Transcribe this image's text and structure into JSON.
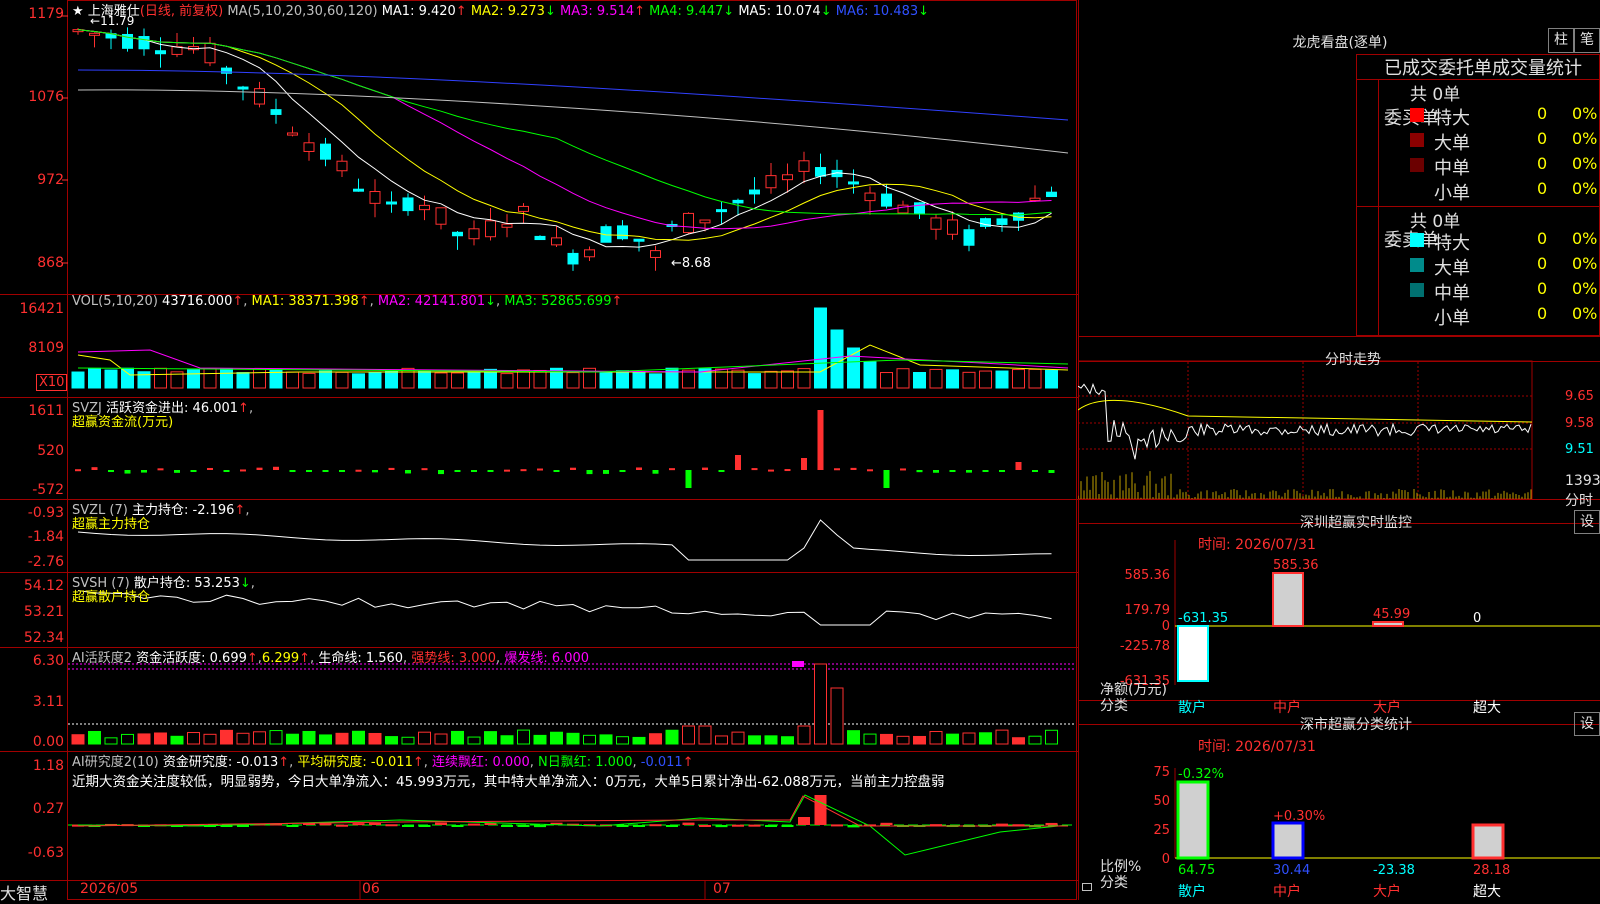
{
  "stock": {
    "name": "上海雅仕",
    "period": "(日线, 前复权)",
    "ma_label": "MA(5,10,20,30,60,120)",
    "ma": [
      {
        "label": "MA1: 9.420",
        "arrow": "↑"
      },
      {
        "label": "MA2: 9.273",
        "arrow": "↓"
      },
      {
        "label": "MA3: 9.514",
        "arrow": "↑"
      },
      {
        "label": "MA4: 9.447",
        "arrow": "↓"
      },
      {
        "label": "MA5: 10.074",
        "arrow": "↓"
      },
      {
        "label": "MA6: 10.483",
        "arrow": "↓"
      }
    ],
    "high_marker": "11.79",
    "low_marker": "8.68",
    "price_axis": [
      "1179",
      "1076",
      "972",
      "868"
    ]
  },
  "vol": {
    "label": "VOL(5,10,20)",
    "value": "43716.000",
    "ma1": "MA1: 38371.398",
    "ma2": "MA2: 42141.801",
    "ma3": "MA3: 52865.699",
    "axis": [
      "16421",
      "8109"
    ],
    "unit": "X10"
  },
  "svzj": {
    "label": "SVZJ",
    "title": "活跃资金进出: 46.001",
    "sub": "超赢资金流(万元)",
    "axis": [
      "1611",
      "520",
      "-572"
    ]
  },
  "svzl": {
    "label": "SVZL (7)",
    "title": "主力持仓: -2.196",
    "sub": "超赢主力持仓",
    "axis": [
      "-0.93",
      "-1.84",
      "-2.76"
    ]
  },
  "svsh": {
    "label": "SVSH (7)",
    "title": "散户持仓: 53.253",
    "sub": "超赢散户持仓",
    "axis": [
      "54.12",
      "53.21",
      "52.34"
    ]
  },
  "ai1": {
    "label": "AI活跃度2",
    "a": "资金活跃度: 0.699",
    "b": "6.299",
    "c": "生命线: 1.560",
    "d": "强势线: 3.000",
    "e": "爆发线: 6.000",
    "axis": [
      "6.30",
      "3.11",
      "0.00"
    ]
  },
  "ai2": {
    "label": "AI研究度2(10)",
    "a": "资金研究度: -0.013",
    "b": "平均研究度: -0.011",
    "c": "连续飘红: 0.000",
    "d": "N日飘红: 1.000",
    "e": "-0.011",
    "comment": "近期大资金关注度较低，明显弱势，今日大单净流入：45.993万元，其中特大单净流入：0万元，大单5日累计净出-62.088万元，当前主力控盘弱",
    "axis": [
      "1.18",
      "0.27",
      "-0.63"
    ]
  },
  "xaxis": {
    "brand": "大智慧",
    "labels": [
      "2026/05",
      "06",
      "07"
    ]
  },
  "dragon": {
    "title": "龙虎看盘(逐单)",
    "btn1": "柱",
    "btn2": "笔",
    "tabs": "已成交委托单成交量统计",
    "buy_side": "委买单",
    "sell_side": "委卖单",
    "buy_total": "共 0单",
    "sell_total": "共 0单",
    "rows": [
      {
        "name": "特大",
        "n": "0",
        "p": "0%"
      },
      {
        "name": "大单",
        "n": "0",
        "p": "0%"
      },
      {
        "name": "中单",
        "n": "0",
        "p": "0%"
      },
      {
        "name": "小单",
        "n": "0",
        "p": "0%"
      }
    ],
    "buy_colors": [
      "#ff0000",
      "#8b0000",
      "#6b0000",
      "#000000"
    ],
    "sell_colors": [
      "#00ffff",
      "#008b8b",
      "#007070",
      "#000000"
    ]
  },
  "minute": {
    "title": "分时走势",
    "price_axis": [
      "9.65",
      "9.58",
      "9.51"
    ],
    "vol_axis": "1393",
    "vol_unit": "分时"
  },
  "sz_monitor": {
    "title": "深圳超赢实时监控",
    "set": "设",
    "time": "时间: 2026/07/31",
    "axis": [
      "585.36",
      "179.79",
      "0",
      "-225.78",
      "-631.35"
    ],
    "ylab1": "净额(万元)",
    "ylab2": "分类",
    "values": [
      "-631.35",
      "585.36",
      "45.99",
      "0"
    ],
    "cats": [
      "散户",
      "中户",
      "大户",
      "超大"
    ]
  },
  "sz_class": {
    "title": "深市超赢分类统计",
    "set": "设",
    "time": "时间: 2026/07/31",
    "axis": [
      "75",
      "50",
      "25",
      "0"
    ],
    "ylab1": "比例%",
    "ylab2": "分类",
    "top_labels": [
      "-0.32%",
      "+0.30%"
    ],
    "values": [
      "64.75",
      "30.44",
      "-23.38",
      "28.18"
    ],
    "cats": [
      "散户",
      "中户",
      "大户",
      "超大"
    ]
  }
}
